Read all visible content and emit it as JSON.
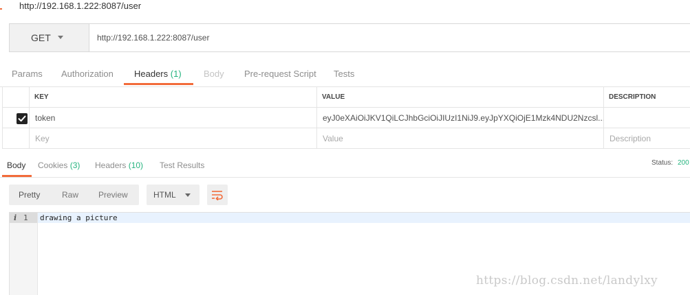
{
  "title": "http://192.168.1.222:8087/user",
  "request": {
    "method": "GET",
    "url": "http://192.168.1.222:8087/user"
  },
  "request_tabs": [
    {
      "label": "Params"
    },
    {
      "label": "Authorization"
    },
    {
      "label": "Headers",
      "count": "(1)"
    },
    {
      "label": "Body"
    },
    {
      "label": "Pre-request Script"
    },
    {
      "label": "Tests"
    }
  ],
  "headers_table": {
    "columns": [
      "KEY",
      "VALUE",
      "DESCRIPTION"
    ],
    "rows": [
      {
        "checked": true,
        "key": "token",
        "value": "eyJ0eXAiOiJKV1QiLCJhbGciOiJIUzI1NiJ9.eyJpYXQiOjE1Mzk4NDU2Nzcsl...",
        "description": ""
      }
    ],
    "placeholders": {
      "key": "Key",
      "value": "Value",
      "description": "Description"
    }
  },
  "response_tabs": [
    {
      "label": "Body"
    },
    {
      "label": "Cookies",
      "count": "(3)"
    },
    {
      "label": "Headers",
      "count": "(10)"
    },
    {
      "label": "Test Results"
    }
  ],
  "status": {
    "label": "Status:",
    "value": "200"
  },
  "format_modes": [
    "Pretty",
    "Raw",
    "Preview"
  ],
  "language": "HTML",
  "editor": {
    "line_number": "1",
    "line_text": "drawing a picture"
  },
  "watermark": "https://blog.csdn.net/landylxy",
  "colors": {
    "accent": "#f26b3a",
    "count": "#26b47f"
  },
  "icons": [
    "chevron-down-icon",
    "checkmark-icon",
    "wrap-lines-icon",
    "info-icon"
  ]
}
